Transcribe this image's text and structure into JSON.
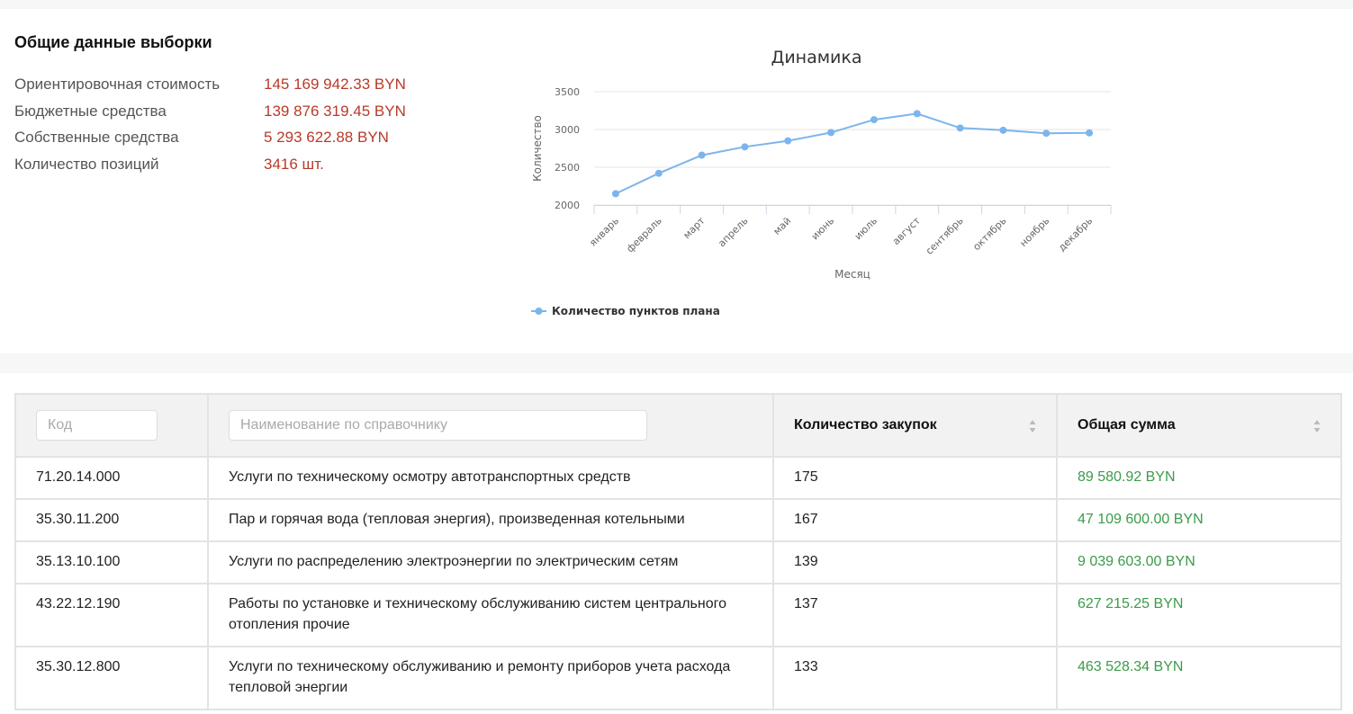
{
  "summary": {
    "title": "Общие данные выборки",
    "rows": [
      {
        "label": "Ориентировочная стоимость",
        "value": "145 169 942.33 BYN"
      },
      {
        "label": "Бюджетные средства",
        "value": "139 876 319.45 BYN"
      },
      {
        "label": "Собственные средства",
        "value": "5 293 622.88 BYN"
      },
      {
        "label": "Количество позиций",
        "value": "3416 шт."
      }
    ]
  },
  "chart_data": {
    "type": "line",
    "title": "Динамика",
    "xlabel": "Месяц",
    "ylabel": "Количество",
    "categories": [
      "январь",
      "февраль",
      "март",
      "апрель",
      "май",
      "июнь",
      "июль",
      "август",
      "сентябрь",
      "октябрь",
      "ноябрь",
      "декабрь"
    ],
    "series": [
      {
        "name": "Количество пунктов плана",
        "values": [
          2150,
          2420,
          2660,
          2770,
          2850,
          2960,
          3130,
          3210,
          3020,
          2990,
          2950,
          2955
        ],
        "color": "#7cb5ec"
      }
    ],
    "ylim": [
      2000,
      3500
    ],
    "yticks": [
      "2000",
      "2500",
      "3000",
      "3500"
    ],
    "legend": "bottom-left",
    "grid": true
  },
  "table": {
    "code_placeholder": "Код",
    "name_placeholder": "Наименование по справочнику",
    "col_count": "Количество закупок",
    "col_sum": "Общая сумма",
    "rows": [
      {
        "code": "71.20.14.000",
        "name": "Услуги по техническому осмотру автотранспортных средств",
        "count": "175",
        "sum": "89 580.92 BYN"
      },
      {
        "code": "35.30.11.200",
        "name": "Пар и горячая вода (тепловая энергия), произведенная котельными",
        "count": "167",
        "sum": "47 109 600.00 BYN"
      },
      {
        "code": "35.13.10.100",
        "name": "Услуги по распределению электроэнергии по электрическим сетям",
        "count": "139",
        "sum": "9 039 603.00 BYN"
      },
      {
        "code": "43.22.12.190",
        "name": "Работы по установке и техническому обслуживанию систем центрального отопления прочие",
        "count": "137",
        "sum": "627 215.25 BYN"
      },
      {
        "code": "35.30.12.800",
        "name": "Услуги по техническому обслуживанию и ремонту приборов учета расхода тепловой энергии",
        "count": "133",
        "sum": "463 528.34 BYN"
      }
    ]
  }
}
